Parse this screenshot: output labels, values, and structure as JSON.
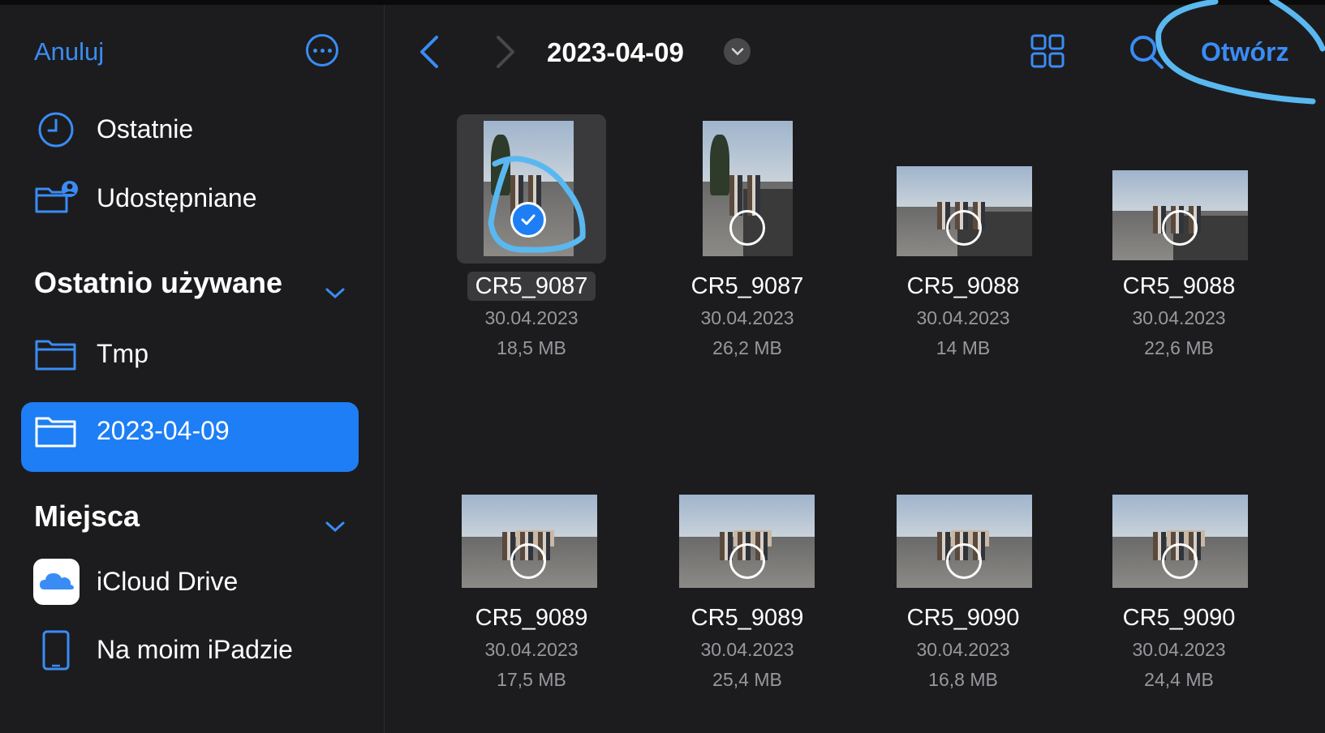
{
  "sidebar": {
    "cancel_label": "Anuluj",
    "items_top": [
      {
        "label": "Ostatnie",
        "icon": "clock-icon"
      },
      {
        "label": "Udostępniane",
        "icon": "shared-folder-icon"
      }
    ],
    "recent_header": "Ostatnio używane",
    "recent_items": [
      {
        "label": "Tmp",
        "icon": "folder-icon"
      },
      {
        "label": "2023-04-09",
        "icon": "folder-icon",
        "selected": true
      }
    ],
    "places_header": "Miejsca",
    "places_items": [
      {
        "label": "iCloud Drive",
        "icon": "icloud-icon"
      },
      {
        "label": "Na moim iPadzie",
        "icon": "ipad-icon"
      }
    ]
  },
  "toolbar": {
    "folder_title": "2023-04-09",
    "open_label": "Otwórz"
  },
  "files": [
    {
      "name": "CR5_9087",
      "date": "30.04.2023",
      "size": "18,5 MB",
      "selected": true
    },
    {
      "name": "CR5_9087",
      "date": "30.04.2023",
      "size": "26,2 MB"
    },
    {
      "name": "CR5_9088",
      "date": "30.04.2023",
      "size": "14 MB"
    },
    {
      "name": "CR5_9088",
      "date": "30.04.2023",
      "size": "22,6 MB"
    },
    {
      "name": "CR5_9089",
      "date": "30.04.2023",
      "size": "17,5 MB"
    },
    {
      "name": "CR5_9089",
      "date": "30.04.2023",
      "size": "25,4 MB"
    },
    {
      "name": "CR5_9090",
      "date": "30.04.2023",
      "size": "16,8 MB"
    },
    {
      "name": "CR5_9090",
      "date": "30.04.2023",
      "size": "24,4 MB"
    }
  ],
  "colors": {
    "accent": "#1d7ef5",
    "link": "#3a8cf5",
    "scribble": "#5ab8f0"
  }
}
